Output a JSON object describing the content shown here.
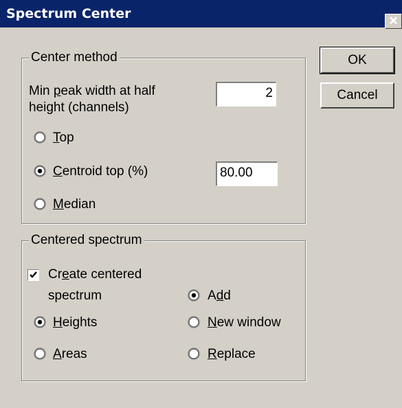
{
  "window": {
    "title": "Spectrum Center",
    "close_glyph": "✕"
  },
  "buttons": {
    "ok": "OK",
    "cancel": "Cancel"
  },
  "center_method": {
    "legend": "Center method",
    "min_peak_label_line1_pre": "Min ",
    "min_peak_label_line1_u": "p",
    "min_peak_label_line1_post": "eak width at half",
    "min_peak_label_line2": "height (channels)",
    "min_peak_value": "2",
    "options": [
      {
        "u": "T",
        "rest": "op",
        "selected": false
      },
      {
        "u": "C",
        "rest": "entroid top (%)",
        "selected": true
      },
      {
        "u": "M",
        "rest": "edian",
        "selected": false
      }
    ],
    "centroid_value": "80.00"
  },
  "centered_spectrum": {
    "legend": "Centered spectrum",
    "create_pre": "Cr",
    "create_u": "e",
    "create_post": "ate centered",
    "create_line2": "spectrum",
    "create_checked": true,
    "measure_options": [
      {
        "u": "H",
        "rest": "eights",
        "selected": true
      },
      {
        "u": "A",
        "rest": "reas",
        "selected": false
      }
    ],
    "output_options": [
      {
        "pre": "A",
        "u": "d",
        "rest": "d",
        "selected": true
      },
      {
        "pre": "",
        "u": "N",
        "rest": "ew window",
        "selected": false
      },
      {
        "pre": "",
        "u": "R",
        "rest": "eplace",
        "selected": false
      }
    ]
  },
  "icons": {
    "radio": "radio-button-icon",
    "check": "checkmark-icon"
  }
}
